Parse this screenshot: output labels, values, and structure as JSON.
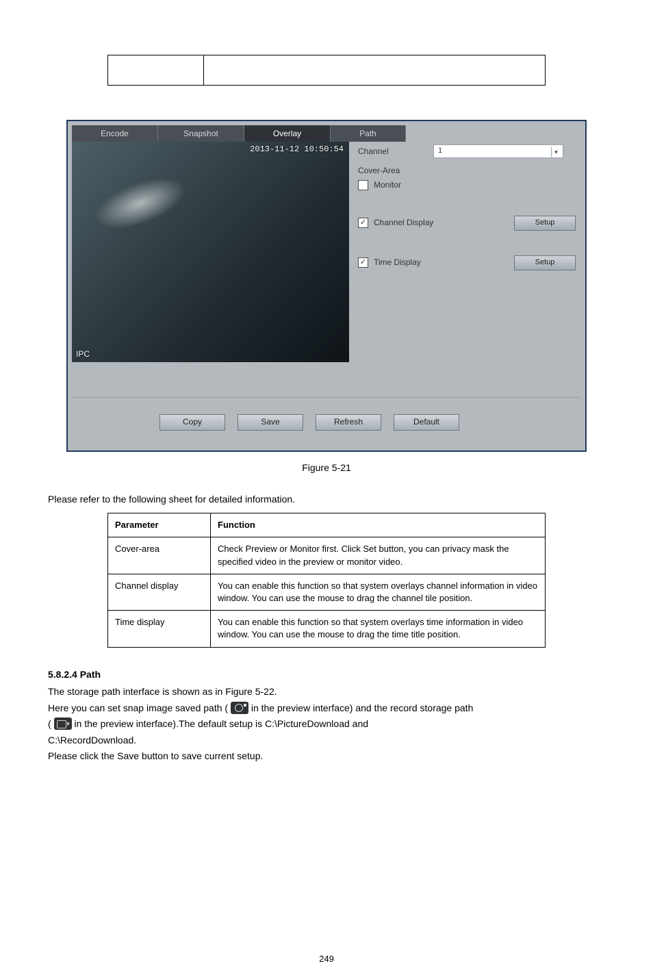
{
  "caption_figure": "Figure 5-21",
  "caption_ref": "Please refer to the following sheet for detailed information.",
  "tabs": {
    "encode": "Encode",
    "snapshot": "Snapshot",
    "overlay": "Overlay",
    "path": "Path"
  },
  "video": {
    "timestamp": "2013-11-12 10:50:54",
    "label": "IPC"
  },
  "side": {
    "channel_label": "Channel",
    "channel_value": "1",
    "cover_area": "Cover-Area",
    "monitor": "Monitor",
    "channel_display": "Channel Display",
    "time_display": "Time Display",
    "setup": "Setup"
  },
  "footer": {
    "copy": "Copy",
    "save": "Save",
    "refresh": "Refresh",
    "default": "Default"
  },
  "param": {
    "header_param": "Parameter",
    "header_func": "Function",
    "rows": [
      {
        "param": "Cover-area",
        "func": "Check Preview or Monitor first. Click Set button, you can privacy mask the specified video in the preview or monitor video."
      },
      {
        "param": "Channel display",
        "func": "You can enable this function so that system overlays channel information in video window. You can use the mouse to drag the channel tile position."
      },
      {
        "param": "Time display",
        "func": "You can enable this function so that system overlays time information in video window. You can use the mouse to drag the time title position."
      }
    ]
  },
  "path": {
    "title": "5.8.2.4 Path",
    "line1_a": "The storage path interface is shown as in Figure 5-22.",
    "line1_b_prefix": "Here you can set snap image saved path (",
    "line1_b_mid": " in the preview interface) and the record storage path",
    "line2_prefix": "(",
    "line2_suffix": "    in the preview interface).The default setup is C:\\PictureDownload and",
    "line3": "C:\\RecordDownload.",
    "line4": "Please click the Save button to save current setup."
  },
  "pageno": "249"
}
